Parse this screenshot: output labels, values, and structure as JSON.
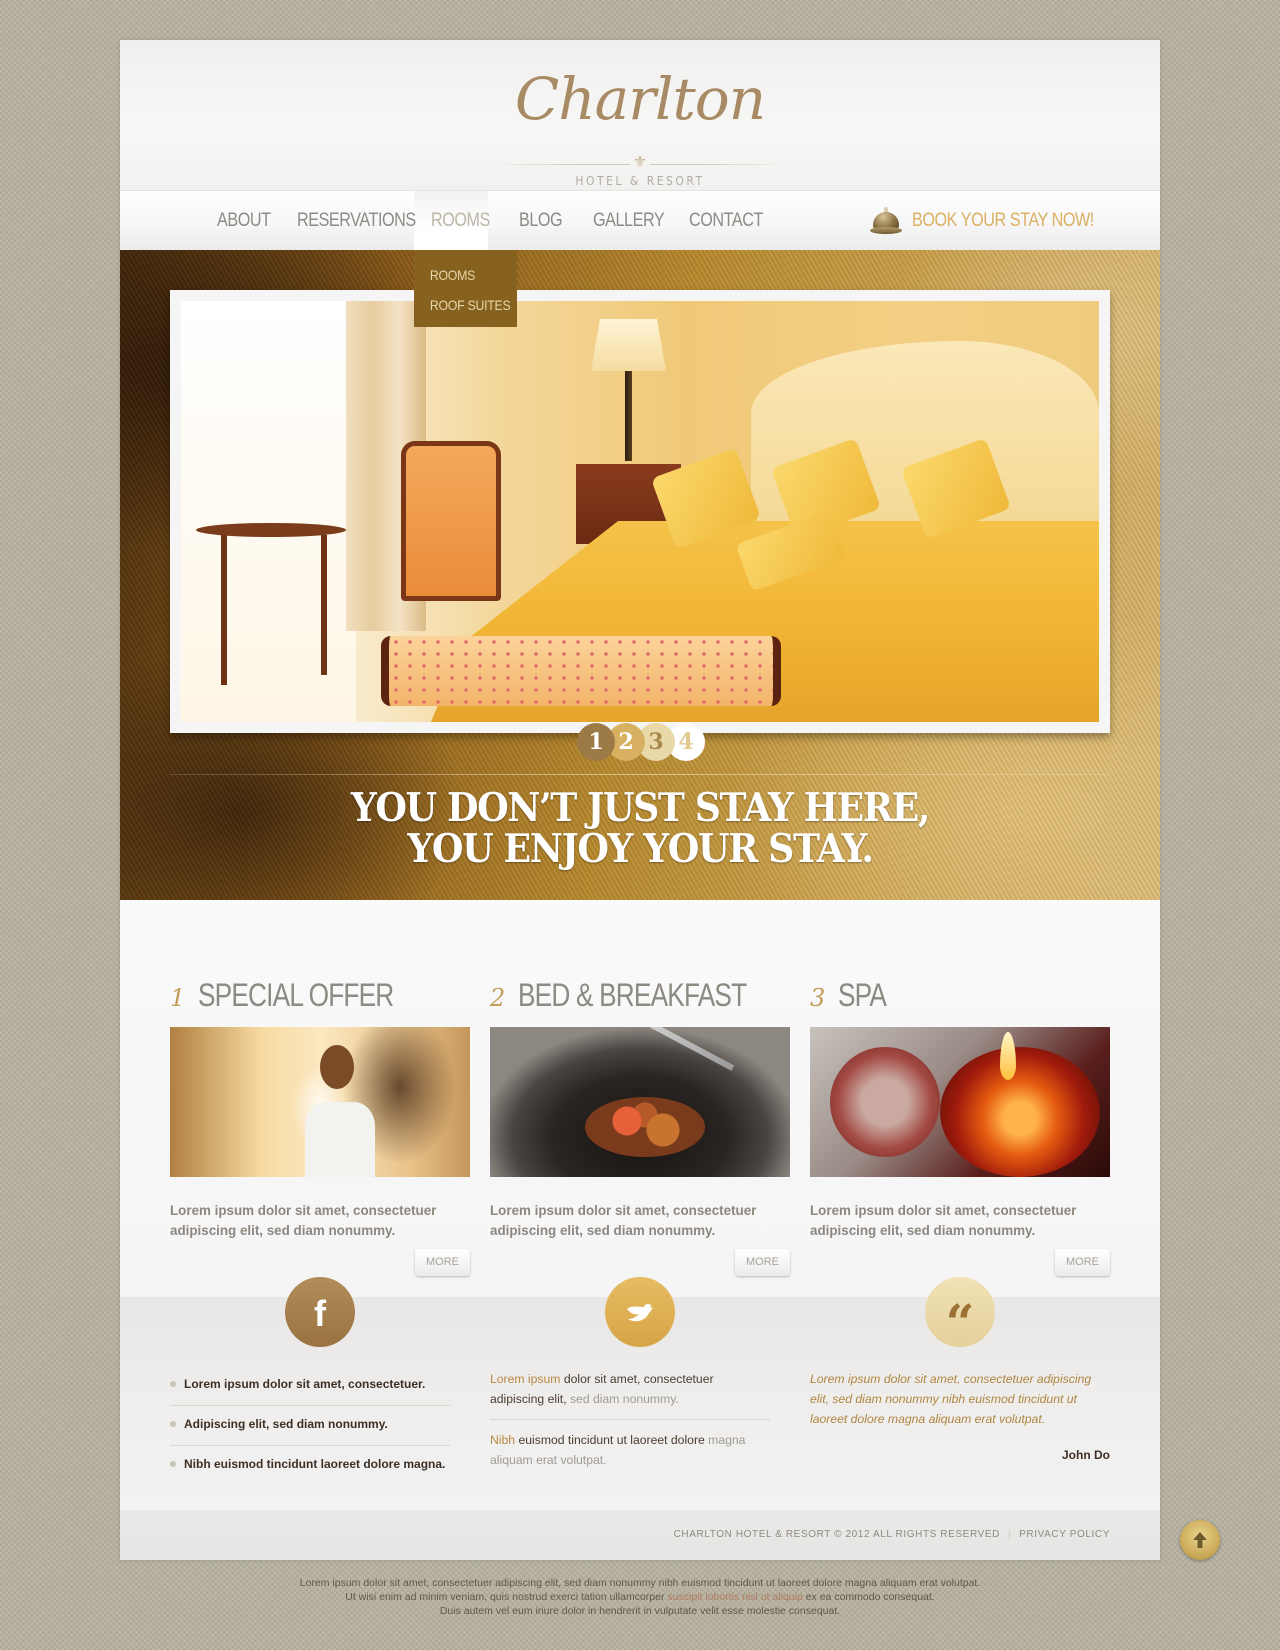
{
  "header": {
    "logo_script": "Charlton",
    "logo_subtitle": "HOTEL & RESORT",
    "logo_ornament": "⚜"
  },
  "nav": {
    "items": [
      {
        "label": "ABOUT"
      },
      {
        "label": "RESERVATIONS"
      },
      {
        "label": "ROOMS",
        "active": true
      },
      {
        "label": "BLOG"
      },
      {
        "label": "GALLERY"
      },
      {
        "label": "CONTACT"
      }
    ],
    "book_label": "BOOK YOUR STAY NOW!",
    "book_icon": "service-bell-icon",
    "dropdown": [
      {
        "label": "ROOMS"
      },
      {
        "label": "ROOF SUITES"
      }
    ]
  },
  "hero": {
    "slides": [
      "1",
      "2",
      "3",
      "4"
    ],
    "active_slide": 1,
    "tagline_line1": "YOU DON’T JUST STAY HERE,",
    "tagline_line2": "YOU ENJOY YOUR STAY."
  },
  "features": [
    {
      "number": "1",
      "title": "SPECIAL OFFER",
      "text": "Lorem ipsum  dolor sit amet, consectetuer adipiscing elit, sed diam nonummy.",
      "more": "MORE"
    },
    {
      "number": "2",
      "title": "BED & BREAKFAST",
      "text": "Lorem ipsum  dolor sit amet, consectetuer adipiscing elit, sed diam nonummy.",
      "more": "MORE"
    },
    {
      "number": "3",
      "title": "SPA",
      "text": "Lorem ipsum  dolor sit amet, consectetuer adipiscing elit, sed diam nonummy.",
      "more": "MORE"
    }
  ],
  "social": {
    "facebook": {
      "icon": "facebook-icon",
      "glyph": "f",
      "items": [
        "Lorem ipsum  dolor sit amet, consectetuer.",
        "Adipiscing elit, sed diam nonummy.",
        "Nibh euismod tincidunt laoreet dolore magna."
      ]
    },
    "twitter": {
      "icon": "twitter-bird-icon",
      "tweets": [
        {
          "highlight": "Lorem ipsum",
          "text": "  dolor sit amet, consectetuer adipiscing elit, ",
          "muted": "sed diam nonummy."
        },
        {
          "highlight": "Nibh",
          "text": " euismod tincidunt ut laoreet dolore ",
          "muted": "magna aliquam erat volutpat."
        }
      ]
    },
    "testimonial": {
      "icon": "quote-icon",
      "glyph": "“",
      "text": "Lorem ipsum dolor sit amet, consectetuer adipiscing elit, sed diam nonummy nibh euismod tincidunt ut laoreet dolore magna aliquam erat volutpat.",
      "author": "John Do"
    }
  },
  "footer": {
    "copyright": "CHARLTON HOTEL & RESORT © 2012 ALL RIGHTS RESERVED",
    "separator": "|",
    "privacy": "PRIVACY POLICY",
    "to_top_icon": "arrow-up-icon"
  },
  "bottom_text": {
    "line1": "Lorem ipsum dolor sit amet, consectetuer adipiscing elit, sed diam nonummy nibh euismod tincidunt ut laoreet dolore magna aliquam erat volutpat.",
    "line2_before": "Ut wisi enim ad minim veniam, quis nostrud exerci tation ullamcorper ",
    "line2_link": "suscipit lobortis nisl ut aliquip",
    "line2_after": " ex ea commodo consequat.",
    "line3": "Duis autem vel eum iriure dolor in hendrerit in vulputate velit esse molestie consequat."
  },
  "colors": {
    "accent_gold": "#dcb062",
    "dropdown_bg": "#86621e",
    "facebook_circle": "#a6804b",
    "twitter_circle": "#deb055",
    "quote_circle": "#eadbab",
    "page_bg": "#b7b2a0"
  }
}
